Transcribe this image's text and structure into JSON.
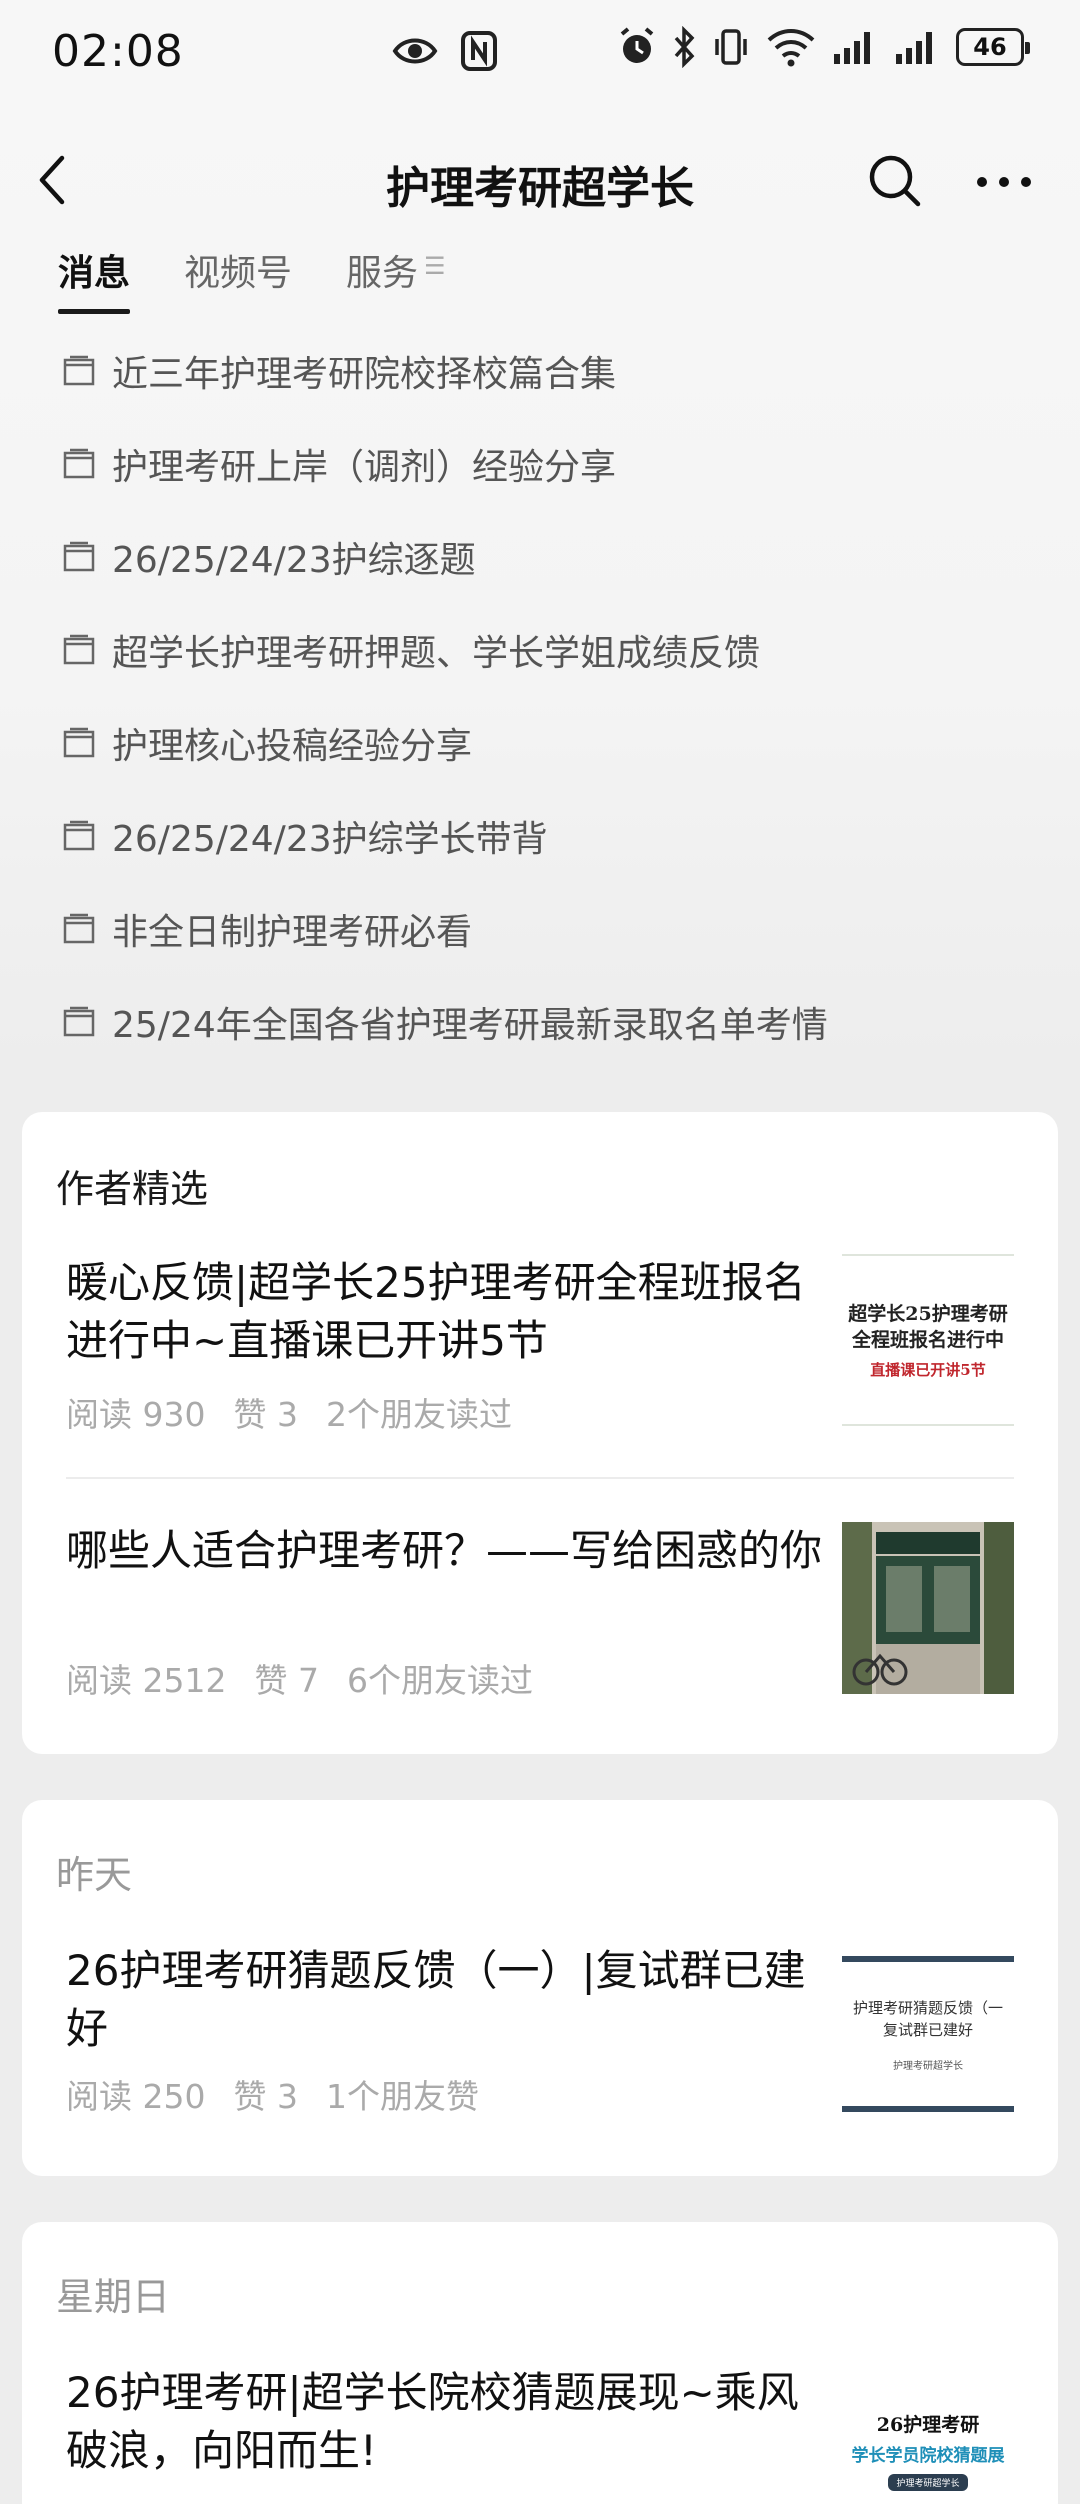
{
  "status_bar": {
    "time": "02:08",
    "battery": "46",
    "icons": [
      "eye-icon",
      "nfc-icon",
      "alarm-icon",
      "bluetooth-icon",
      "vibrate-icon",
      "wifi-icon",
      "signal-icon",
      "signal-icon"
    ]
  },
  "header": {
    "title": "护理考研超学长",
    "icons": [
      "back-icon",
      "search-icon",
      "more-icon"
    ]
  },
  "tabs": [
    {
      "label": "消息",
      "active": true
    },
    {
      "label": "视频号",
      "active": false
    },
    {
      "label": "服务",
      "active": false
    }
  ],
  "menu_items": [
    {
      "label": "近三年护理考研院校择校篇合集"
    },
    {
      "label": "护理考研上岸（调剂）经验分享"
    },
    {
      "label": "26/25/24/23护综逐题"
    },
    {
      "label": "超学长护理考研押题、学长学姐成绩反馈"
    },
    {
      "label": "护理核心投稿经验分享"
    },
    {
      "label": "26/25/24/23护综学长带背"
    },
    {
      "label": "非全日制护理考研必看"
    },
    {
      "label": "25/24年全国各省护理考研最新录取名单考情"
    }
  ],
  "featured": {
    "header": "作者精选",
    "articles": [
      {
        "title": "暖心反馈|超学长25护理考研全程班报名进行中~直播课已开讲5节",
        "reads": "阅读 930",
        "likes": "赞 3",
        "friends": "2个朋友读过",
        "thumb_line1": "超学长25护理考研",
        "thumb_line2": "全程班报名进行中",
        "thumb_line3": "直播课已开讲5节"
      },
      {
        "title": "哪些人适合护理考研？——写给困惑的你",
        "reads": "阅读 2512",
        "likes": "赞 7",
        "friends": "6个朋友读过"
      }
    ]
  },
  "yesterday": {
    "header": "昨天",
    "article": {
      "title": "26护理考研猜题反馈（一）|复试群已建好",
      "reads": "阅读 250",
      "likes": "赞 3",
      "friends": "1个朋友赞",
      "thumb_line1": "护理考研猜题反馈（一",
      "thumb_line2": "复试群已建好",
      "thumb_line3": "护理考研超学长"
    }
  },
  "sunday": {
    "header": "星期日",
    "article": {
      "title": "26护理考研|超学长院校猜题展现~乘风破浪，向阳而生!",
      "thumb_line1": "26护理考研",
      "thumb_line2": "学长学员院校猜题展",
      "thumb_line3": "护理考研超学长"
    }
  },
  "colors": {
    "page_bg": "#ededed",
    "card_bg": "#ffffff",
    "thumb_red": "#c0262d",
    "thumb_blue": "#1f8fb8"
  }
}
